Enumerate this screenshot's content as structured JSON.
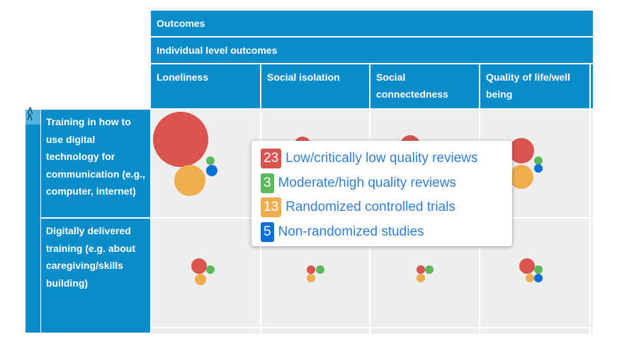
{
  "header": {
    "level1": "Outcomes",
    "level2": "Individual level outcomes",
    "columns": [
      "Loneliness",
      "Social isolation",
      "Social connectedness",
      "Quality of life/well being"
    ]
  },
  "rows": [
    {
      "label": "Training in how to use digital technology for communication (e.g., computer, internet)"
    },
    {
      "label": "Digitally delivered training (e.g. about caregiving/skills building)"
    }
  ],
  "toggle_icon": "double-chevron-up-icon",
  "colors": {
    "header": "#0a8ccb",
    "low_quality": "#d9534f",
    "moderate_quality": "#5cb85c",
    "rct": "#f0ad4e",
    "non_randomized": "#0a6fd8"
  },
  "tooltip": {
    "items": [
      {
        "count": "23",
        "label": "Low/critically low quality reviews",
        "color": "#d9534f"
      },
      {
        "count": "3",
        "label": "Moderate/high quality reviews",
        "color": "#5cb85c"
      },
      {
        "count": "13",
        "label": "Randomized controlled trials",
        "color": "#f0ad4e"
      },
      {
        "count": "5",
        "label": "Non-randomized studies",
        "color": "#0a6fd8"
      }
    ]
  }
}
